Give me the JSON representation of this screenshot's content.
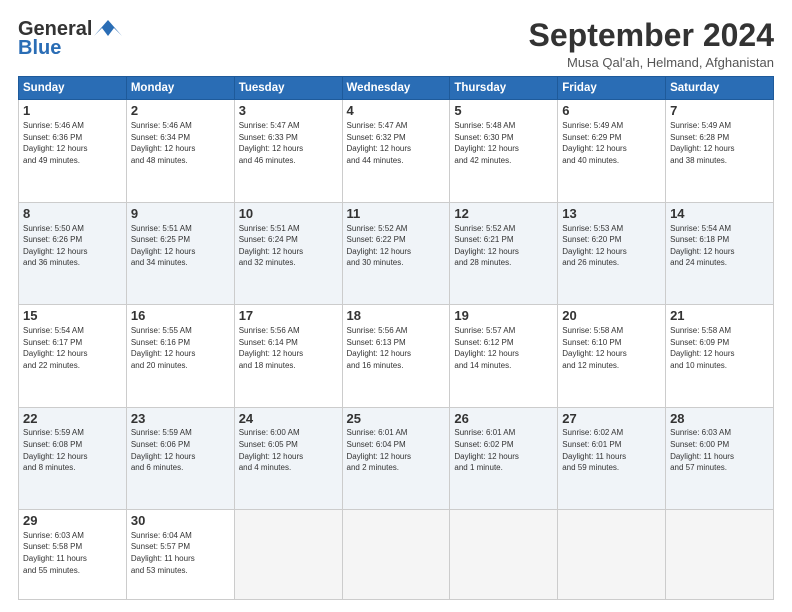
{
  "header": {
    "logo_general": "General",
    "logo_blue": "Blue",
    "month_title": "September 2024",
    "location": "Musa Qal'ah, Helmand, Afghanistan"
  },
  "weekdays": [
    "Sunday",
    "Monday",
    "Tuesday",
    "Wednesday",
    "Thursday",
    "Friday",
    "Saturday"
  ],
  "weeks": [
    [
      {
        "day": "1",
        "info": "Sunrise: 5:46 AM\nSunset: 6:36 PM\nDaylight: 12 hours\nand 49 minutes."
      },
      {
        "day": "2",
        "info": "Sunrise: 5:46 AM\nSunset: 6:34 PM\nDaylight: 12 hours\nand 48 minutes."
      },
      {
        "day": "3",
        "info": "Sunrise: 5:47 AM\nSunset: 6:33 PM\nDaylight: 12 hours\nand 46 minutes."
      },
      {
        "day": "4",
        "info": "Sunrise: 5:47 AM\nSunset: 6:32 PM\nDaylight: 12 hours\nand 44 minutes."
      },
      {
        "day": "5",
        "info": "Sunrise: 5:48 AM\nSunset: 6:30 PM\nDaylight: 12 hours\nand 42 minutes."
      },
      {
        "day": "6",
        "info": "Sunrise: 5:49 AM\nSunset: 6:29 PM\nDaylight: 12 hours\nand 40 minutes."
      },
      {
        "day": "7",
        "info": "Sunrise: 5:49 AM\nSunset: 6:28 PM\nDaylight: 12 hours\nand 38 minutes."
      }
    ],
    [
      {
        "day": "8",
        "info": "Sunrise: 5:50 AM\nSunset: 6:26 PM\nDaylight: 12 hours\nand 36 minutes."
      },
      {
        "day": "9",
        "info": "Sunrise: 5:51 AM\nSunset: 6:25 PM\nDaylight: 12 hours\nand 34 minutes."
      },
      {
        "day": "10",
        "info": "Sunrise: 5:51 AM\nSunset: 6:24 PM\nDaylight: 12 hours\nand 32 minutes."
      },
      {
        "day": "11",
        "info": "Sunrise: 5:52 AM\nSunset: 6:22 PM\nDaylight: 12 hours\nand 30 minutes."
      },
      {
        "day": "12",
        "info": "Sunrise: 5:52 AM\nSunset: 6:21 PM\nDaylight: 12 hours\nand 28 minutes."
      },
      {
        "day": "13",
        "info": "Sunrise: 5:53 AM\nSunset: 6:20 PM\nDaylight: 12 hours\nand 26 minutes."
      },
      {
        "day": "14",
        "info": "Sunrise: 5:54 AM\nSunset: 6:18 PM\nDaylight: 12 hours\nand 24 minutes."
      }
    ],
    [
      {
        "day": "15",
        "info": "Sunrise: 5:54 AM\nSunset: 6:17 PM\nDaylight: 12 hours\nand 22 minutes."
      },
      {
        "day": "16",
        "info": "Sunrise: 5:55 AM\nSunset: 6:16 PM\nDaylight: 12 hours\nand 20 minutes."
      },
      {
        "day": "17",
        "info": "Sunrise: 5:56 AM\nSunset: 6:14 PM\nDaylight: 12 hours\nand 18 minutes."
      },
      {
        "day": "18",
        "info": "Sunrise: 5:56 AM\nSunset: 6:13 PM\nDaylight: 12 hours\nand 16 minutes."
      },
      {
        "day": "19",
        "info": "Sunrise: 5:57 AM\nSunset: 6:12 PM\nDaylight: 12 hours\nand 14 minutes."
      },
      {
        "day": "20",
        "info": "Sunrise: 5:58 AM\nSunset: 6:10 PM\nDaylight: 12 hours\nand 12 minutes."
      },
      {
        "day": "21",
        "info": "Sunrise: 5:58 AM\nSunset: 6:09 PM\nDaylight: 12 hours\nand 10 minutes."
      }
    ],
    [
      {
        "day": "22",
        "info": "Sunrise: 5:59 AM\nSunset: 6:08 PM\nDaylight: 12 hours\nand 8 minutes."
      },
      {
        "day": "23",
        "info": "Sunrise: 5:59 AM\nSunset: 6:06 PM\nDaylight: 12 hours\nand 6 minutes."
      },
      {
        "day": "24",
        "info": "Sunrise: 6:00 AM\nSunset: 6:05 PM\nDaylight: 12 hours\nand 4 minutes."
      },
      {
        "day": "25",
        "info": "Sunrise: 6:01 AM\nSunset: 6:04 PM\nDaylight: 12 hours\nand 2 minutes."
      },
      {
        "day": "26",
        "info": "Sunrise: 6:01 AM\nSunset: 6:02 PM\nDaylight: 12 hours\nand 1 minute."
      },
      {
        "day": "27",
        "info": "Sunrise: 6:02 AM\nSunset: 6:01 PM\nDaylight: 11 hours\nand 59 minutes."
      },
      {
        "day": "28",
        "info": "Sunrise: 6:03 AM\nSunset: 6:00 PM\nDaylight: 11 hours\nand 57 minutes."
      }
    ],
    [
      {
        "day": "29",
        "info": "Sunrise: 6:03 AM\nSunset: 5:58 PM\nDaylight: 11 hours\nand 55 minutes."
      },
      {
        "day": "30",
        "info": "Sunrise: 6:04 AM\nSunset: 5:57 PM\nDaylight: 11 hours\nand 53 minutes."
      },
      {
        "day": "",
        "info": ""
      },
      {
        "day": "",
        "info": ""
      },
      {
        "day": "",
        "info": ""
      },
      {
        "day": "",
        "info": ""
      },
      {
        "day": "",
        "info": ""
      }
    ]
  ]
}
